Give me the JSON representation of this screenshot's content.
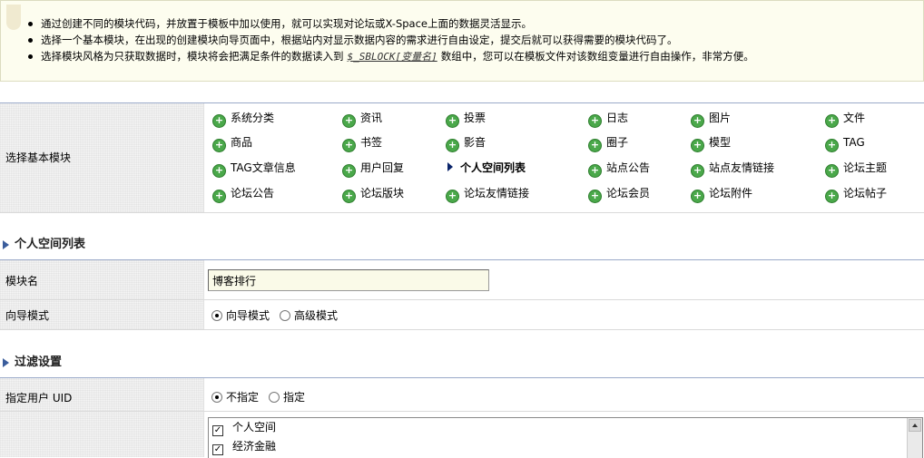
{
  "tips": {
    "line1": "通过创建不同的模块代码，并放置于模板中加以使用，就可以实现对论坛或X-Space上面的数据灵活显示。",
    "line2": "选择一个基本模块，在出现的创建模块向导页面中，根据站内对显示数据内容的需求进行自由设定，提交后就可以获得需要的模块代码了。",
    "line3_pre": "选择模块风格为只获取数据时，模块将会把满足条件的数据读入到",
    "line3_var": "$_SBLOCK[变量名]",
    "line3_post": "数组中，您可以在模板文件对该数组变量进行自由操作，非常方便。"
  },
  "modules": {
    "label": "选择基本模块",
    "items": [
      [
        "系统分类",
        "资讯",
        "投票",
        "日志",
        "图片",
        "文件"
      ],
      [
        "商品",
        "书签",
        "影音",
        "圈子",
        "模型",
        "TAG"
      ],
      [
        "TAG文章信息",
        "用户回复",
        "个人空间列表",
        "站点公告",
        "站点友情链接",
        "论坛主题"
      ],
      [
        "论坛公告",
        "论坛版块",
        "论坛友情链接",
        "论坛会员",
        "论坛附件",
        "论坛帖子"
      ]
    ]
  },
  "section1": {
    "title": "个人空间列表"
  },
  "module_name": {
    "label": "模块名",
    "value": "博客排行"
  },
  "wizard_mode": {
    "label": "向导模式",
    "option1": "向导模式",
    "option2": "高级模式",
    "selected": "向导模式"
  },
  "section2": {
    "title": "过滤设置"
  },
  "uid": {
    "label": "指定用户 UID",
    "option1": "不指定",
    "option2": "指定",
    "selected": "不指定"
  },
  "categories": {
    "items": [
      "个人空间",
      "经济金融"
    ]
  }
}
